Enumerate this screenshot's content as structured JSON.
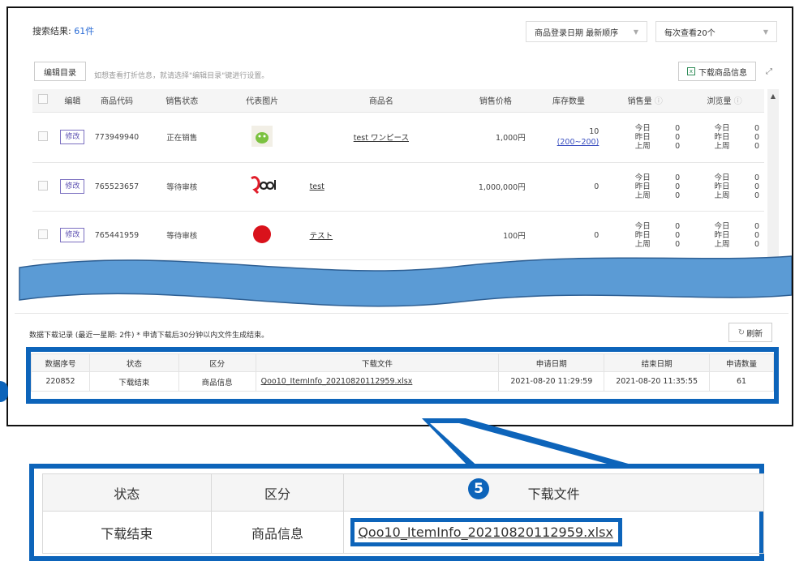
{
  "search": {
    "label": "搜索结果",
    "count": "61件"
  },
  "sort_select": "商品登录日期 最新顺序",
  "per_page_select": "每次查看20个",
  "toolbar": {
    "edit_list_label": "编辑目录",
    "hint": "如想查看打折信息，就请选择\"编辑目录\"键进行设置。",
    "download_info_label": "下载商品信息"
  },
  "product_table": {
    "headers": [
      "编辑",
      "商品代码",
      "销售状态",
      "代表图片",
      "商品名",
      "销售价格",
      "库存数量",
      "销售量",
      "浏览量"
    ],
    "rows": [
      {
        "edit": "修改",
        "code": "773949940",
        "status": "正在销售",
        "name": "test ワンピース",
        "price": "1,000円",
        "stock": "10",
        "stock_range": "(200~200)"
      },
      {
        "edit": "修改",
        "code": "765523657",
        "status": "等待审核",
        "name": "test",
        "price": "1,000,000円",
        "stock": "0",
        "stock_range": ""
      },
      {
        "edit": "修改",
        "code": "765441959",
        "status": "等待审核",
        "name": "テスト",
        "price": "100円",
        "stock": "0",
        "stock_range": ""
      }
    ],
    "stat_labels": [
      "今日",
      "昨日",
      "上周"
    ],
    "stat_value": "0"
  },
  "download_log": {
    "title": "数据下载记录 (最近一星期: 2件) * 申请下载后30分钟以内文件生成结束。",
    "refresh_label": "刷新",
    "headers": [
      "数据序号",
      "状态",
      "区分",
      "下载文件",
      "申请日期",
      "结束日期",
      "申请数量"
    ],
    "row": {
      "id": "220852",
      "status": "下载结束",
      "type": "商品信息",
      "file": "Qoo10_ItemInfo_20210820112959.xlsx",
      "requested": "2021-08-20 11:29:59",
      "finished": "2021-08-20 11:35:55",
      "qty": "61"
    }
  },
  "zoom": {
    "marker": "5",
    "headers": [
      "状态",
      "区分",
      "下载文件"
    ],
    "row": {
      "status": "下载结束",
      "type": "商品信息",
      "file": "Qoo10_ItemInfo_20210820112959.xlsx"
    }
  },
  "colors": {
    "annotation_blue": "#0d64ba",
    "wave_blue": "#5b9bd5"
  }
}
